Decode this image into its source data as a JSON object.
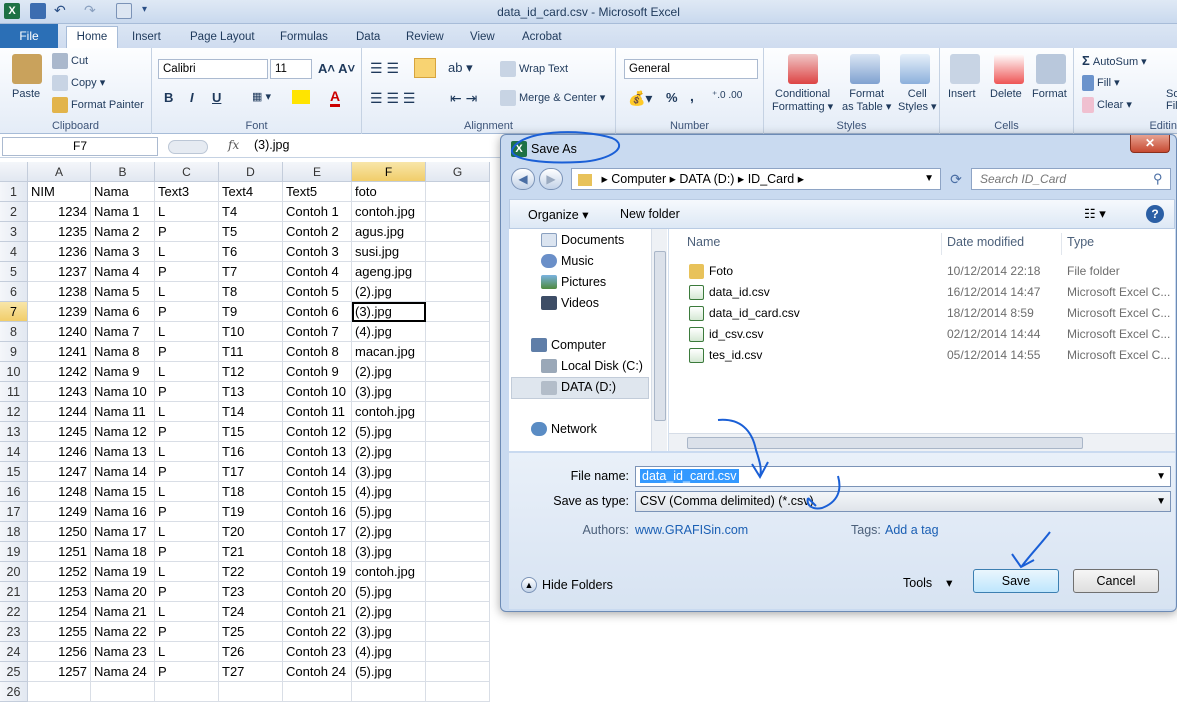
{
  "window": {
    "title": "data_id_card.csv - Microsoft Excel"
  },
  "tabs": [
    "File",
    "Home",
    "Insert",
    "Page Layout",
    "Formulas",
    "Data",
    "Review",
    "View",
    "Acrobat"
  ],
  "ribbon": {
    "clipboard": {
      "paste": "Paste",
      "cut": "Cut",
      "copy": "Copy",
      "format_painter": "Format Painter",
      "label": "Clipboard"
    },
    "font": {
      "name": "Calibri",
      "size": "11",
      "bold": "B",
      "italic": "I",
      "underline": "U",
      "label": "Font"
    },
    "alignment": {
      "wrap": "Wrap Text",
      "merge": "Merge & Center",
      "label": "Alignment"
    },
    "number": {
      "format": "General",
      "percent": "%",
      "comma": ",",
      "label": "Number"
    },
    "styles": {
      "conditional": "Conditional",
      "conditional2": "Formatting",
      "table": "Format",
      "table2": "as Table",
      "cell": "Cell",
      "cell2": "Styles",
      "label": "Styles"
    },
    "cells": {
      "insert": "Insert",
      "delete": "Delete",
      "format": "Format",
      "label": "Cells"
    },
    "editing": {
      "autosum": "AutoSum",
      "fill": "Fill",
      "clear": "Clear",
      "sort1": "So",
      "sort2": "Fil",
      "label": "Editin"
    }
  },
  "formula_bar": {
    "name_box": "F7",
    "fx": "fx",
    "content": "(3).jpg"
  },
  "sheet": {
    "columns": [
      "A",
      "B",
      "C",
      "D",
      "E",
      "F",
      "G"
    ],
    "headers": [
      "NIM",
      "Nama",
      "Text3",
      "Text4",
      "Text5",
      "foto"
    ],
    "rows": [
      [
        "1234",
        "Nama 1",
        "L",
        "T4",
        "Contoh 1",
        "contoh.jpg"
      ],
      [
        "1235",
        "Nama 2",
        "P",
        "T5",
        "Contoh 2",
        "agus.jpg"
      ],
      [
        "1236",
        "Nama 3",
        "L",
        "T6",
        "Contoh 3",
        "susi.jpg"
      ],
      [
        "1237",
        "Nama 4",
        "P",
        "T7",
        "Contoh 4",
        "ageng.jpg"
      ],
      [
        "1238",
        "Nama 5",
        "L",
        "T8",
        "Contoh 5",
        "(2).jpg"
      ],
      [
        "1239",
        "Nama 6",
        "P",
        "T9",
        "Contoh 6",
        "(3).jpg"
      ],
      [
        "1240",
        "Nama 7",
        "L",
        "T10",
        "Contoh 7",
        "(4).jpg"
      ],
      [
        "1241",
        "Nama 8",
        "P",
        "T11",
        "Contoh 8",
        "macan.jpg"
      ],
      [
        "1242",
        "Nama 9",
        "L",
        "T12",
        "Contoh 9",
        "(2).jpg"
      ],
      [
        "1243",
        "Nama 10",
        "P",
        "T13",
        "Contoh 10",
        "(3).jpg"
      ],
      [
        "1244",
        "Nama 11",
        "L",
        "T14",
        "Contoh 11",
        "contoh.jpg"
      ],
      [
        "1245",
        "Nama 12",
        "P",
        "T15",
        "Contoh 12",
        "(5).jpg"
      ],
      [
        "1246",
        "Nama 13",
        "L",
        "T16",
        "Contoh 13",
        "(2).jpg"
      ],
      [
        "1247",
        "Nama 14",
        "P",
        "T17",
        "Contoh 14",
        "(3).jpg"
      ],
      [
        "1248",
        "Nama 15",
        "L",
        "T18",
        "Contoh 15",
        "(4).jpg"
      ],
      [
        "1249",
        "Nama 16",
        "P",
        "T19",
        "Contoh 16",
        "(5).jpg"
      ],
      [
        "1250",
        "Nama 17",
        "L",
        "T20",
        "Contoh 17",
        "(2).jpg"
      ],
      [
        "1251",
        "Nama 18",
        "P",
        "T21",
        "Contoh 18",
        "(3).jpg"
      ],
      [
        "1252",
        "Nama 19",
        "L",
        "T22",
        "Contoh 19",
        "contoh.jpg"
      ],
      [
        "1253",
        "Nama 20",
        "P",
        "T23",
        "Contoh 20",
        "(5).jpg"
      ],
      [
        "1254",
        "Nama 21",
        "L",
        "T24",
        "Contoh 21",
        "(2).jpg"
      ],
      [
        "1255",
        "Nama 22",
        "P",
        "T25",
        "Contoh 22",
        "(3).jpg"
      ],
      [
        "1256",
        "Nama 23",
        "L",
        "T26",
        "Contoh 23",
        "(4).jpg"
      ],
      [
        "1257",
        "Nama 24",
        "P",
        "T27",
        "Contoh 24",
        "(5).jpg"
      ]
    ],
    "selected_cell": "F7"
  },
  "dialog": {
    "title": "Save As",
    "close": "✕",
    "breadcrumb": [
      "Computer",
      "DATA (D:)",
      "ID_Card"
    ],
    "search_placeholder": "Search ID_Card",
    "organize": "Organize",
    "new_folder": "New folder",
    "nav": {
      "documents": "Documents",
      "music": "Music",
      "pictures": "Pictures",
      "videos": "Videos",
      "computer": "Computer",
      "local_disk": "Local Disk (C:)",
      "data_drive": "DATA (D:)",
      "network": "Network"
    },
    "columns": {
      "name": "Name",
      "date": "Date modified",
      "type": "Type"
    },
    "files": [
      {
        "name": "Foto",
        "date": "10/12/2014 22:18",
        "type": "File folder",
        "icon": "folder-icon"
      },
      {
        "name": "data_id.csv",
        "date": "16/12/2014 14:47",
        "type": "Microsoft Excel C...",
        "icon": "excel-file-icon"
      },
      {
        "name": "data_id_card.csv",
        "date": "18/12/2014 8:59",
        "type": "Microsoft Excel C...",
        "icon": "excel-file-icon"
      },
      {
        "name": "id_csv.csv",
        "date": "02/12/2014 14:44",
        "type": "Microsoft Excel C...",
        "icon": "excel-file-icon"
      },
      {
        "name": "tes_id.csv",
        "date": "05/12/2014 14:55",
        "type": "Microsoft Excel C...",
        "icon": "excel-file-icon"
      }
    ],
    "file_name_label": "File name:",
    "file_name": "data_id_card.csv",
    "save_type_label": "Save as type:",
    "save_type": "CSV (Comma delimited) (*.csv)",
    "authors_label": "Authors:",
    "authors": "www.GRAFISin.com",
    "tags_label": "Tags:",
    "tags": "Add a tag",
    "hide_folders": "Hide Folders",
    "tools": "Tools",
    "save": "Save",
    "cancel": "Cancel"
  },
  "colors": {
    "accent": "#2b6fb6",
    "excel_green": "#1e7145",
    "annotation": "#1a5fd6"
  }
}
